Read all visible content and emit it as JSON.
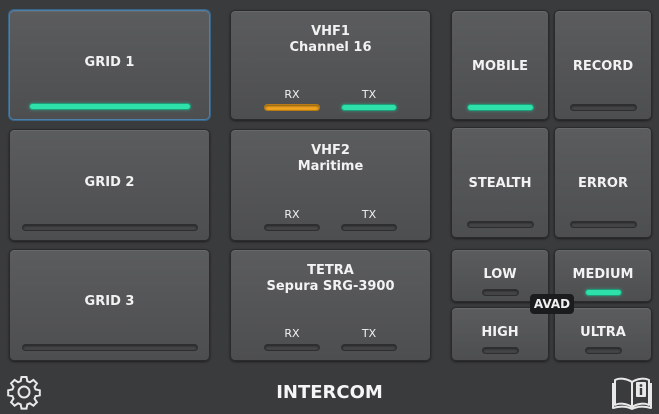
{
  "grids": [
    {
      "label": "GRID 1",
      "active": true
    },
    {
      "label": "GRID 2",
      "active": false
    },
    {
      "label": "GRID 3",
      "active": false
    }
  ],
  "radios": [
    {
      "line1": "VHF1",
      "line2": "Channel 16",
      "rx_label": "RX",
      "tx_label": "TX",
      "rx": "orange",
      "tx": "green"
    },
    {
      "line1": "VHF2",
      "line2": "Maritime",
      "rx_label": "RX",
      "tx_label": "TX",
      "rx": "off",
      "tx": "off"
    },
    {
      "line1": "TETRA",
      "line2": "Sepura SRG-3900",
      "rx_label": "RX",
      "tx_label": "TX",
      "rx": "off",
      "tx": "off"
    }
  ],
  "modes": [
    {
      "label": "MOBILE",
      "active": true
    },
    {
      "label": "RECORD",
      "active": false
    },
    {
      "label": "STEALTH",
      "active": false
    },
    {
      "label": "ERROR",
      "active": false
    }
  ],
  "levels": [
    {
      "label": "LOW",
      "active": false
    },
    {
      "label": "MEDIUM",
      "active": true
    },
    {
      "label": "HIGH",
      "active": false
    },
    {
      "label": "ULTRA",
      "active": false
    }
  ],
  "avad_label": "AVAD",
  "footer": {
    "title": "INTERCOM",
    "settings_icon": "gear-icon",
    "manual_icon": "book-info-icon"
  },
  "colors": {
    "green": "#2ee0aa",
    "orange": "#f3a51f",
    "selected_border": "#4d7fa8"
  }
}
